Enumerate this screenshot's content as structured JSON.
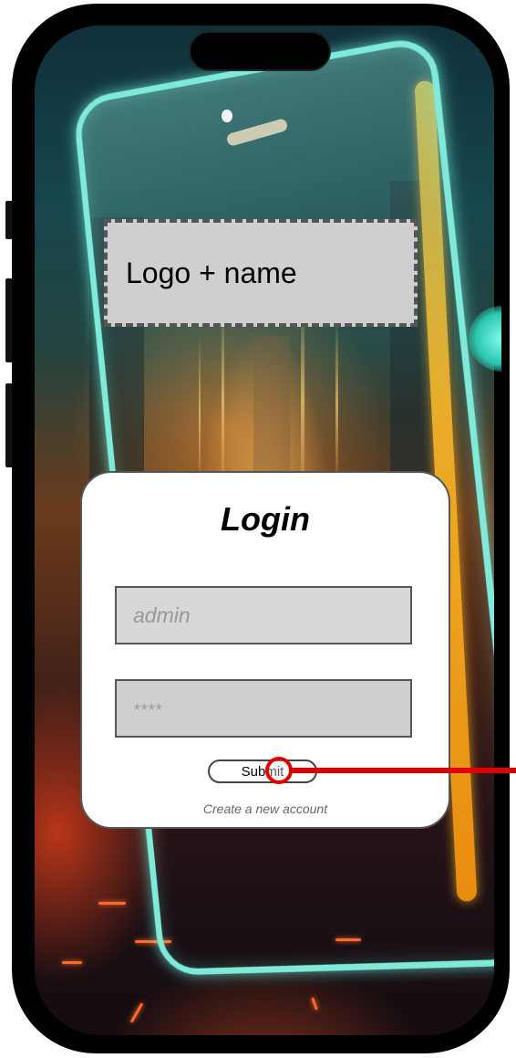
{
  "logo": {
    "placeholder_text": "Logo + name"
  },
  "login": {
    "title": "Login",
    "username_placeholder": "admin",
    "password_placeholder": "****",
    "submit_label": "Submit",
    "create_account_label": "Create a new account"
  },
  "colors": {
    "card_background": "#ffffff",
    "field_background": "#d8d8d8",
    "logo_placeholder_background": "#cfcfcf",
    "click_marker": "#e00000",
    "neon_frame": "#7fe9da",
    "neon_edge": "#ffb020"
  }
}
